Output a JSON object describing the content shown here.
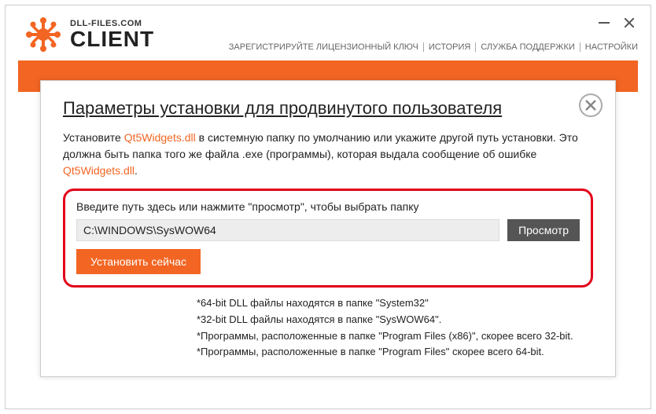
{
  "logo": {
    "sub": "DLL-FILES.COM",
    "main": "CLIENT"
  },
  "nav": {
    "register": "ЗАРЕГИСТРИРУЙТЕ ЛИЦЕНЗИОННЫЙ КЛЮЧ",
    "history": "ИСТОРИЯ",
    "support": "СЛУЖБА ПОДДЕРЖКИ",
    "settings": "НАСТРОЙКИ"
  },
  "modal": {
    "title": "Параметры установки для продвинутого пользователя",
    "desc_1": "Установите ",
    "dll_1": "Qt5Widgets.dll",
    "desc_2": " в системную папку по умолчанию или укажите другой путь установки. Это должна быть папка того же файла .exe (программы), которая выдала сообщение об ошибке ",
    "dll_2": "Qt5Widgets.dll",
    "desc_3": ".",
    "path_label": "Введите путь здесь или нажмите \"просмотр\", чтобы выбрать папку",
    "path_value": "C:\\WINDOWS\\SysWOW64",
    "browse": "Просмотр",
    "install": "Установить сейчас",
    "note1": "*64-bit DLL файлы находятся в папке \"System32\"",
    "note2": "*32-bit DLL файлы находятся в папке \"SysWOW64\".",
    "note3": "*Программы, расположенные в папке \"Program Files (x86)\", скорее всего 32-bit.",
    "note4": "*Программы, расположенные в папке \"Program Files\" скорее всего 64-bit."
  }
}
